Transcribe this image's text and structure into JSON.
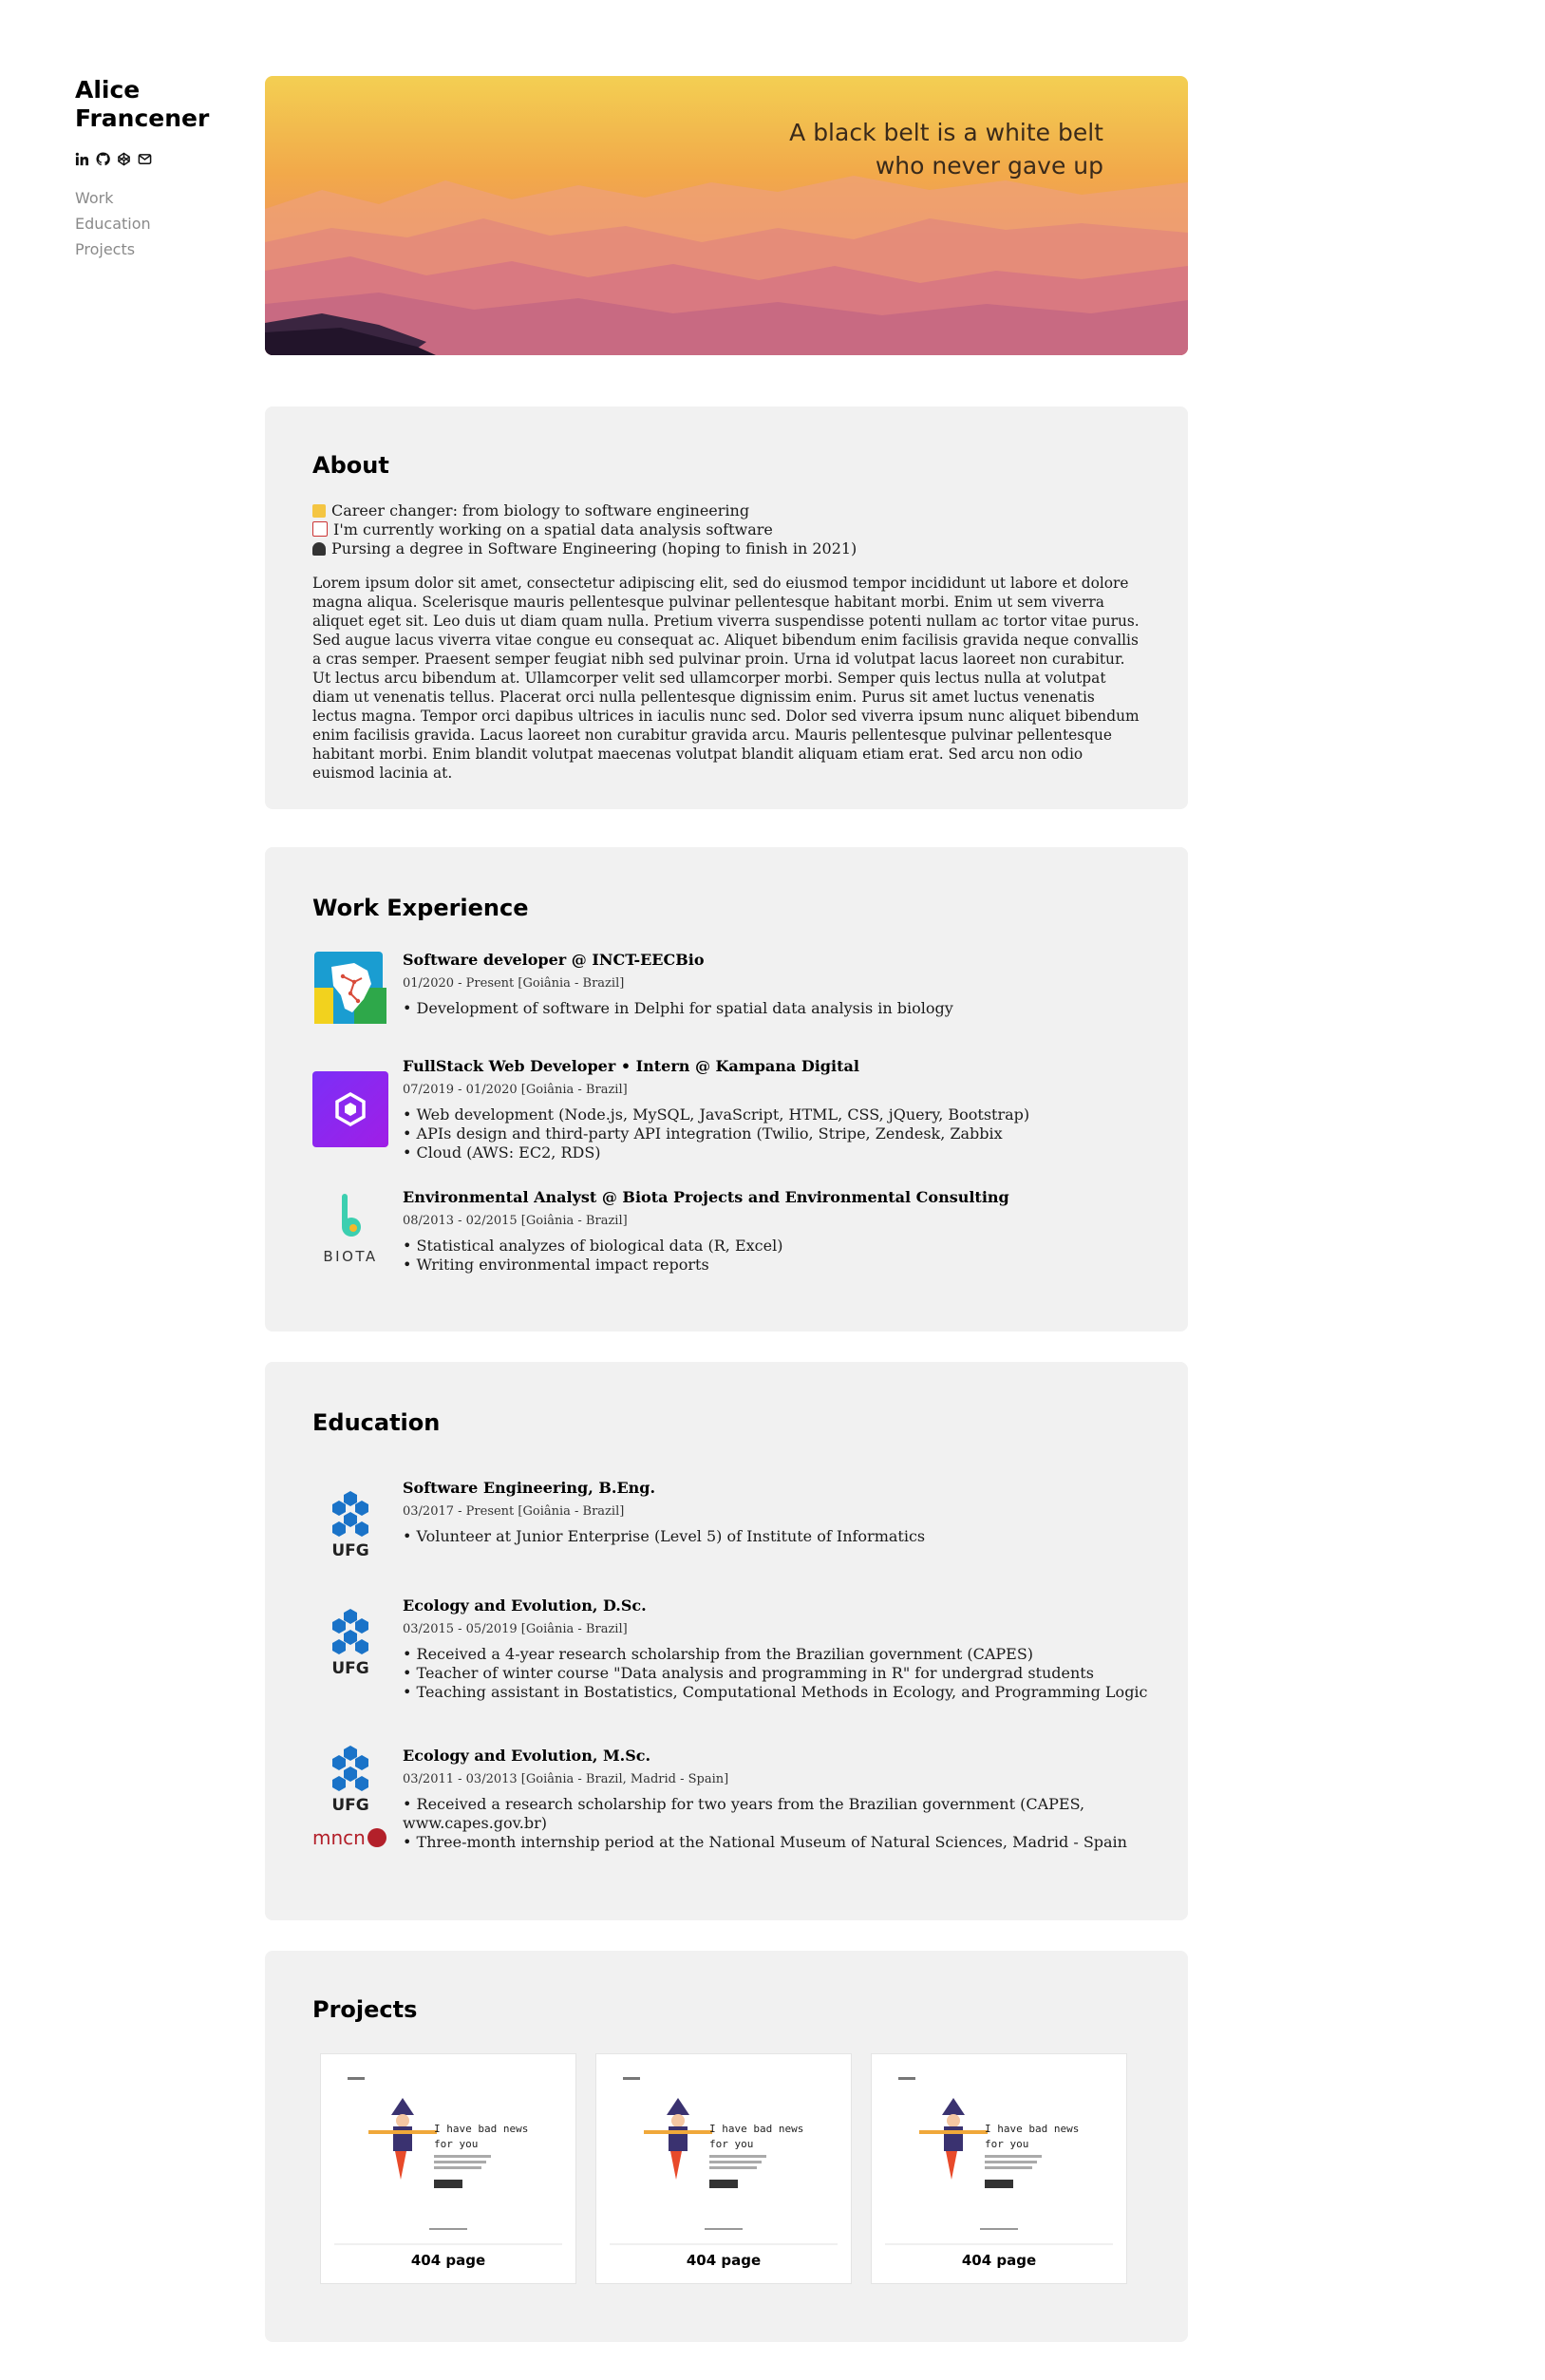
{
  "profile": {
    "first_name": "Alice",
    "last_name": "Francener",
    "social": [
      "linkedin-icon",
      "github-icon",
      "codepen-icon",
      "mail-icon"
    ]
  },
  "nav": {
    "work": "Work",
    "education": "Education",
    "projects": "Projects"
  },
  "hero": {
    "quote_line1": "A black belt is a white belt",
    "quote_line2": "who never gave up"
  },
  "about": {
    "title": "About",
    "highlights": [
      "Career changer: from biology to software engineering",
      "I'm currently working on a spatial data analysis software",
      "Pursing a degree in Software Engineering (hoping to finish in 2021)"
    ],
    "text": "Lorem ipsum dolor sit amet, consectetur adipiscing elit, sed do eiusmod tempor incididunt ut labore et dolore magna aliqua. Scelerisque mauris pellentesque pulvinar pellentesque habitant morbi. Enim ut sem viverra aliquet eget sit. Leo duis ut diam quam nulla. Pretium viverra suspendisse potenti nullam ac tortor vitae purus. Sed augue lacus viverra vitae congue eu consequat ac. Aliquet bibendum enim facilisis gravida neque convallis a cras semper. Praesent semper feugiat nibh sed pulvinar proin. Urna id volutpat lacus laoreet non curabitur. Ut lectus arcu bibendum at. Ullamcorper velit sed ullamcorper morbi. Semper quis lectus nulla at volutpat diam ut venenatis tellus. Placerat orci nulla pellentesque dignissim enim. Purus sit amet luctus venenatis lectus magna. Tempor orci dapibus ultrices in iaculis nunc sed. Dolor sed viverra ipsum nunc aliquet bibendum enim facilisis gravida. Lacus laoreet non curabitur gravida arcu. Mauris pellentesque pulvinar pellentesque habitant morbi. Enim blandit volutpat maecenas volutpat blandit aliquam etiam erat. Sed arcu non odio euismod lacinia at."
  },
  "work": {
    "title": "Work Experience",
    "items": [
      {
        "title": "Software developer @ INCT-EECBio",
        "dates": "01/2020 - Present [Goiânia - Brazil]",
        "bullets": [
          "• Development of software in Delphi for spatial data analysis in biology"
        ]
      },
      {
        "title": "FullStack Web Developer • Intern @ Kampana Digital",
        "dates": "07/2019 - 01/2020 [Goiânia - Brazil]",
        "bullets": [
          "• Web development (Node.js, MySQL, JavaScript, HTML, CSS, jQuery, Bootstrap)",
          "• APIs design and third-party API integration (Twilio, Stripe, Zendesk, Zabbix",
          "• Cloud (AWS: EC2, RDS)"
        ]
      },
      {
        "title": "Environmental Analyst @ Biota Projects and Environmental Consulting",
        "dates": "08/2013 - 02/2015 [Goiânia - Brazil]",
        "logo_text": "BIOTA",
        "bullets": [
          "• Statistical analyzes of biological data (R, Excel)",
          "• Writing environmental impact reports"
        ]
      }
    ]
  },
  "education": {
    "title": "Education",
    "logo_text": "UFG",
    "logo2_text": "mncn",
    "items": [
      {
        "title": "Software Engineering, B.Eng.",
        "dates": "03/2017 - Present [Goiânia - Brazil]",
        "bullets": [
          "• Volunteer at Junior Enterprise (Level 5) of Institute of Informatics"
        ]
      },
      {
        "title": "Ecology and Evolution, D.Sc.",
        "dates": "03/2015 - 05/2019 [Goiânia - Brazil]",
        "bullets": [
          "• Received a 4-year research scholarship from the Brazilian government (CAPES)",
          "• Teacher of winter course \"Data analysis and programming in R\" for undergrad students",
          "• Teaching assistant in Bostatistics, Computational Methods in Ecology, and Programming Logic"
        ]
      },
      {
        "title": "Ecology and Evolution, M.Sc.",
        "dates": "03/2011 - 03/2013 [Goiânia - Brazil, Madrid - Spain]",
        "bullets": [
          "• Received a research scholarship for two years from the Brazilian government (CAPES, www.capes.gov.br)",
          "• Three-month internship period at the National Museum of Natural Sciences, Madrid - Spain"
        ]
      }
    ]
  },
  "projects": {
    "title": "Projects",
    "thumb_text_line1": "I have bad news",
    "thumb_text_line2": "for you",
    "items": [
      {
        "label": "404 page"
      },
      {
        "label": "404 page"
      },
      {
        "label": "404 page"
      }
    ]
  },
  "colors": {
    "card_bg": "#f1f1f1",
    "kampana_purple": "#8a2be2",
    "ufg_blue": "#1a73c8",
    "mncn_red": "#b3202a"
  }
}
